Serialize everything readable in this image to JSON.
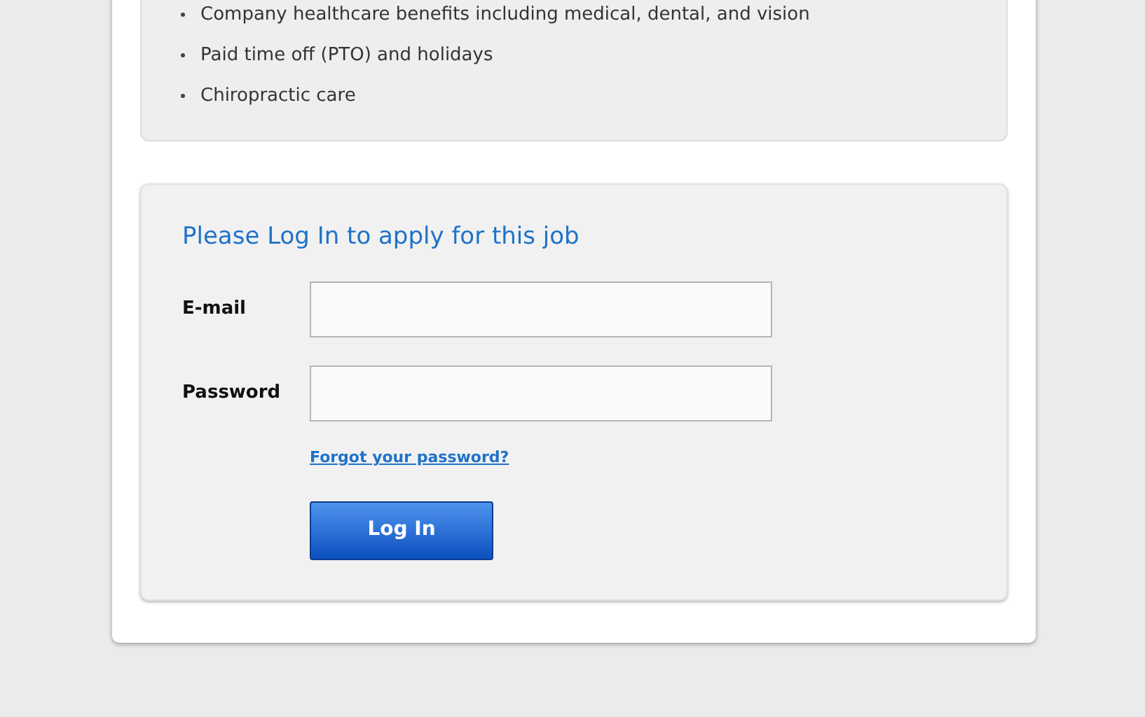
{
  "benefits": [
    "Company healthcare benefits including medical, dental, and vision",
    "Paid time off (PTO) and holidays",
    "Chiropractic care"
  ],
  "login": {
    "title": "Please Log In to apply for this job",
    "fields": [
      {
        "label": "E-mail"
      },
      {
        "label": "Password"
      }
    ],
    "forgot_link": "Forgot your password?",
    "button": "Log In"
  }
}
